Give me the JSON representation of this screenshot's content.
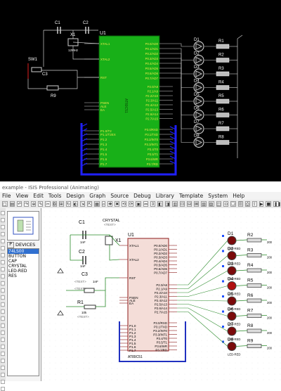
{
  "top_schematic": {
    "mcu_name": "U1",
    "mcu_part": "AT89C51",
    "crystal_label": "X1",
    "crystal_freq": "12MHz",
    "switch_label": "SW1",
    "resistor_reset": "R9",
    "cap_labels": [
      "C1",
      "C2",
      "C3"
    ],
    "left_pins": [
      "XTAL1",
      "XTAL2",
      "RST",
      "PSEN",
      "ALE",
      "EA",
      "P1.0/T2",
      "P1.1/T2EX",
      "P1.2",
      "P1.3",
      "P1.4",
      "P1.5",
      "P1.6",
      "P1.7"
    ],
    "right_pins_p0": [
      "P0.0/AD0",
      "P0.1/AD1",
      "P0.2/AD2",
      "P0.3/AD3",
      "P0.4/AD4",
      "P0.5/AD5",
      "P0.6/AD6",
      "P0.7/AD7"
    ],
    "right_pins_p2": [
      "P2.0/A8",
      "P2.1/A9",
      "P2.2/A10",
      "P2.3/A11",
      "P2.4/A12",
      "P2.5/A13",
      "P2.6/A14",
      "P2.7/A15"
    ],
    "right_pins_p3": [
      "P3.0/RXD",
      "P3.1/TXD",
      "P3.2/INT0",
      "P3.3/INT1",
      "P3.4/T0",
      "P3.5/T1",
      "P3.6/WR",
      "P3.7/RD"
    ],
    "leds": [
      "D1",
      "D2",
      "D3",
      "D4",
      "D5",
      "D6",
      "D7",
      "D8"
    ],
    "resistors": [
      "R1",
      "R2",
      "R3",
      "R4",
      "R5",
      "R6",
      "R7",
      "R8"
    ]
  },
  "window": {
    "title": "example - ISIS Professional (Animating)",
    "menu": [
      "File",
      "View",
      "Edit",
      "Tools",
      "Design",
      "Graph",
      "Source",
      "Debug",
      "Library",
      "Template",
      "System",
      "Help"
    ]
  },
  "sidebar": {
    "pick_button": "P",
    "devices_title": "DEVICES",
    "devices": [
      "74LS00",
      "BUTTON",
      "CAP",
      "CRYSTAL",
      "LED-RED",
      "RES"
    ],
    "selected_index": 0
  },
  "schematic": {
    "c1": "C1",
    "c1_val": "1nF",
    "c2": "C2",
    "c2_val": "1nF",
    "c3": "C3",
    "c3_val": "1nF",
    "crystal": "CRYSTAL",
    "x1": "X1",
    "text_placeholder": "<TEXT>",
    "r1": "R1",
    "r1_val": "10k",
    "u1": "U1",
    "mcu_part": "AT89C51",
    "left_pins": [
      "XTAL1",
      "XTAL2",
      "RST",
      "PSEN",
      "ALE",
      "EA",
      "P1.0",
      "P1.1",
      "P1.2",
      "P1.3",
      "P1.4",
      "P1.5",
      "P1.6",
      "P1.7"
    ],
    "right_pins": [
      "P0.0/AD0",
      "P0.1/AD1",
      "P0.2/AD2",
      "P0.3/AD3",
      "P0.4/AD4",
      "P0.5/AD5",
      "P0.6/AD6",
      "P0.7/AD7",
      "P2.0/A8",
      "P2.1/A9",
      "P2.2/A10",
      "P2.3/A11",
      "P2.4/A12",
      "P2.5/A13",
      "P2.6/A14",
      "P2.7/A15",
      "P3.0/RXD",
      "P3.1/TXD",
      "P3.2/INT0",
      "P3.3/INT1",
      "P3.4/T0",
      "P3.5/T1",
      "P3.6/WR",
      "P3.7/RD"
    ],
    "led_part": "LED-RED",
    "leds": [
      "D1",
      "D2",
      "D3",
      "D4",
      "D5",
      "D6",
      "D7",
      "D8"
    ],
    "resistors": [
      "R2",
      "R3",
      "R4",
      "R5",
      "R6",
      "R7",
      "R8",
      "R9"
    ],
    "res_value": "200"
  }
}
